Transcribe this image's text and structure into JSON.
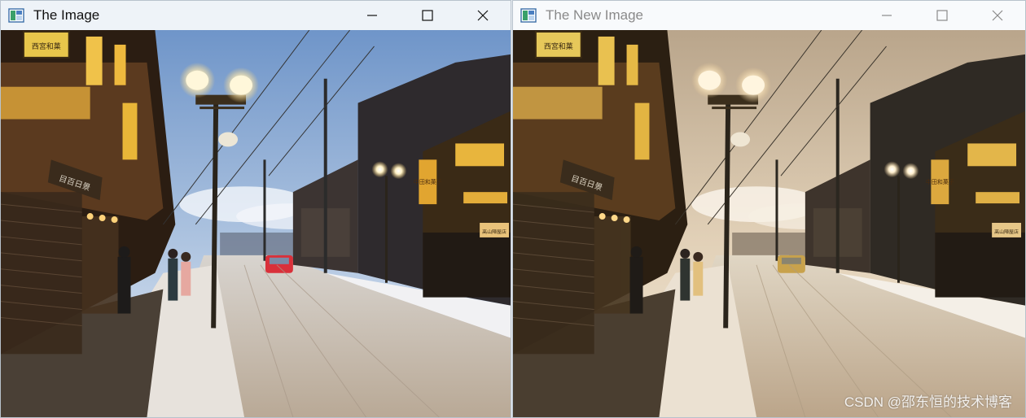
{
  "windows": [
    {
      "title": "The Image",
      "active": true,
      "controls": {
        "minimize_icon": "minimize-icon",
        "maximize_icon": "maximize-icon",
        "close_icon": "close-icon"
      }
    },
    {
      "title": "The New Image",
      "active": false,
      "controls": {
        "minimize_icon": "minimize-icon",
        "maximize_icon": "maximize-icon",
        "close_icon": "close-icon"
      }
    }
  ],
  "images": {
    "original": {
      "description": "Snowy street at dusk with lit street lamps, wooden buildings and a red car",
      "sky_top": "#6f95c9",
      "sky_bottom": "#e8eef6",
      "road": "#c9c2b9",
      "car": "#d9303a"
    },
    "processed": {
      "description": "Same scene with warm sepia-toned color grading",
      "sky_top": "#b9a58b",
      "sky_bottom": "#f3e8d6",
      "road": "#d0c3ac",
      "car": "#c8a24c"
    }
  },
  "signs": {
    "shop_sign_top": "西宮和菓",
    "shop_sign_mid": "目百日景",
    "shop_sign_right": "中田和菓子",
    "shop_sign_small": "高山陣屋店"
  },
  "watermark": "CSDN @邵东恒的技术博客"
}
